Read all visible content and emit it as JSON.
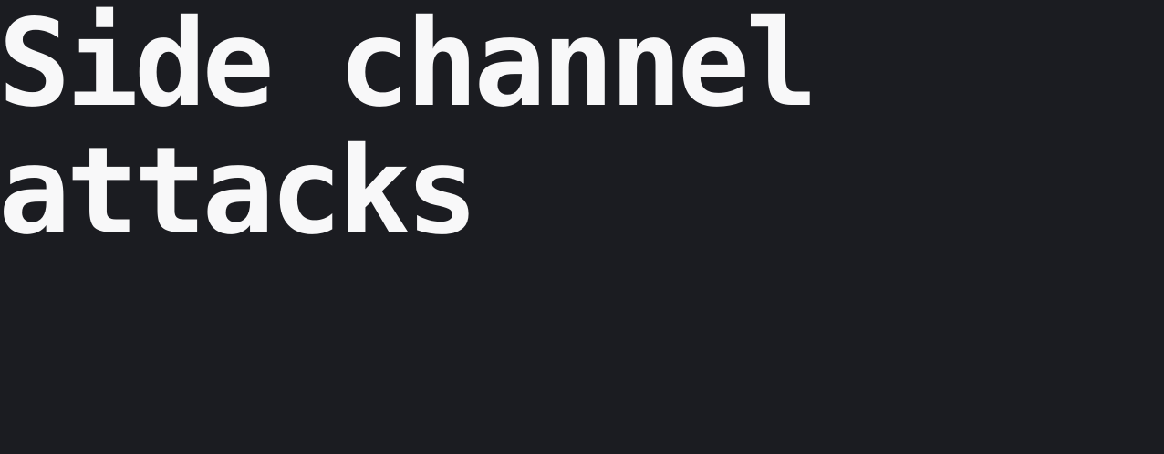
{
  "title": {
    "line1": "Side channel",
    "line2": "attacks"
  },
  "colors": {
    "background": "#1b1c21",
    "text": "#f8f8f9"
  }
}
